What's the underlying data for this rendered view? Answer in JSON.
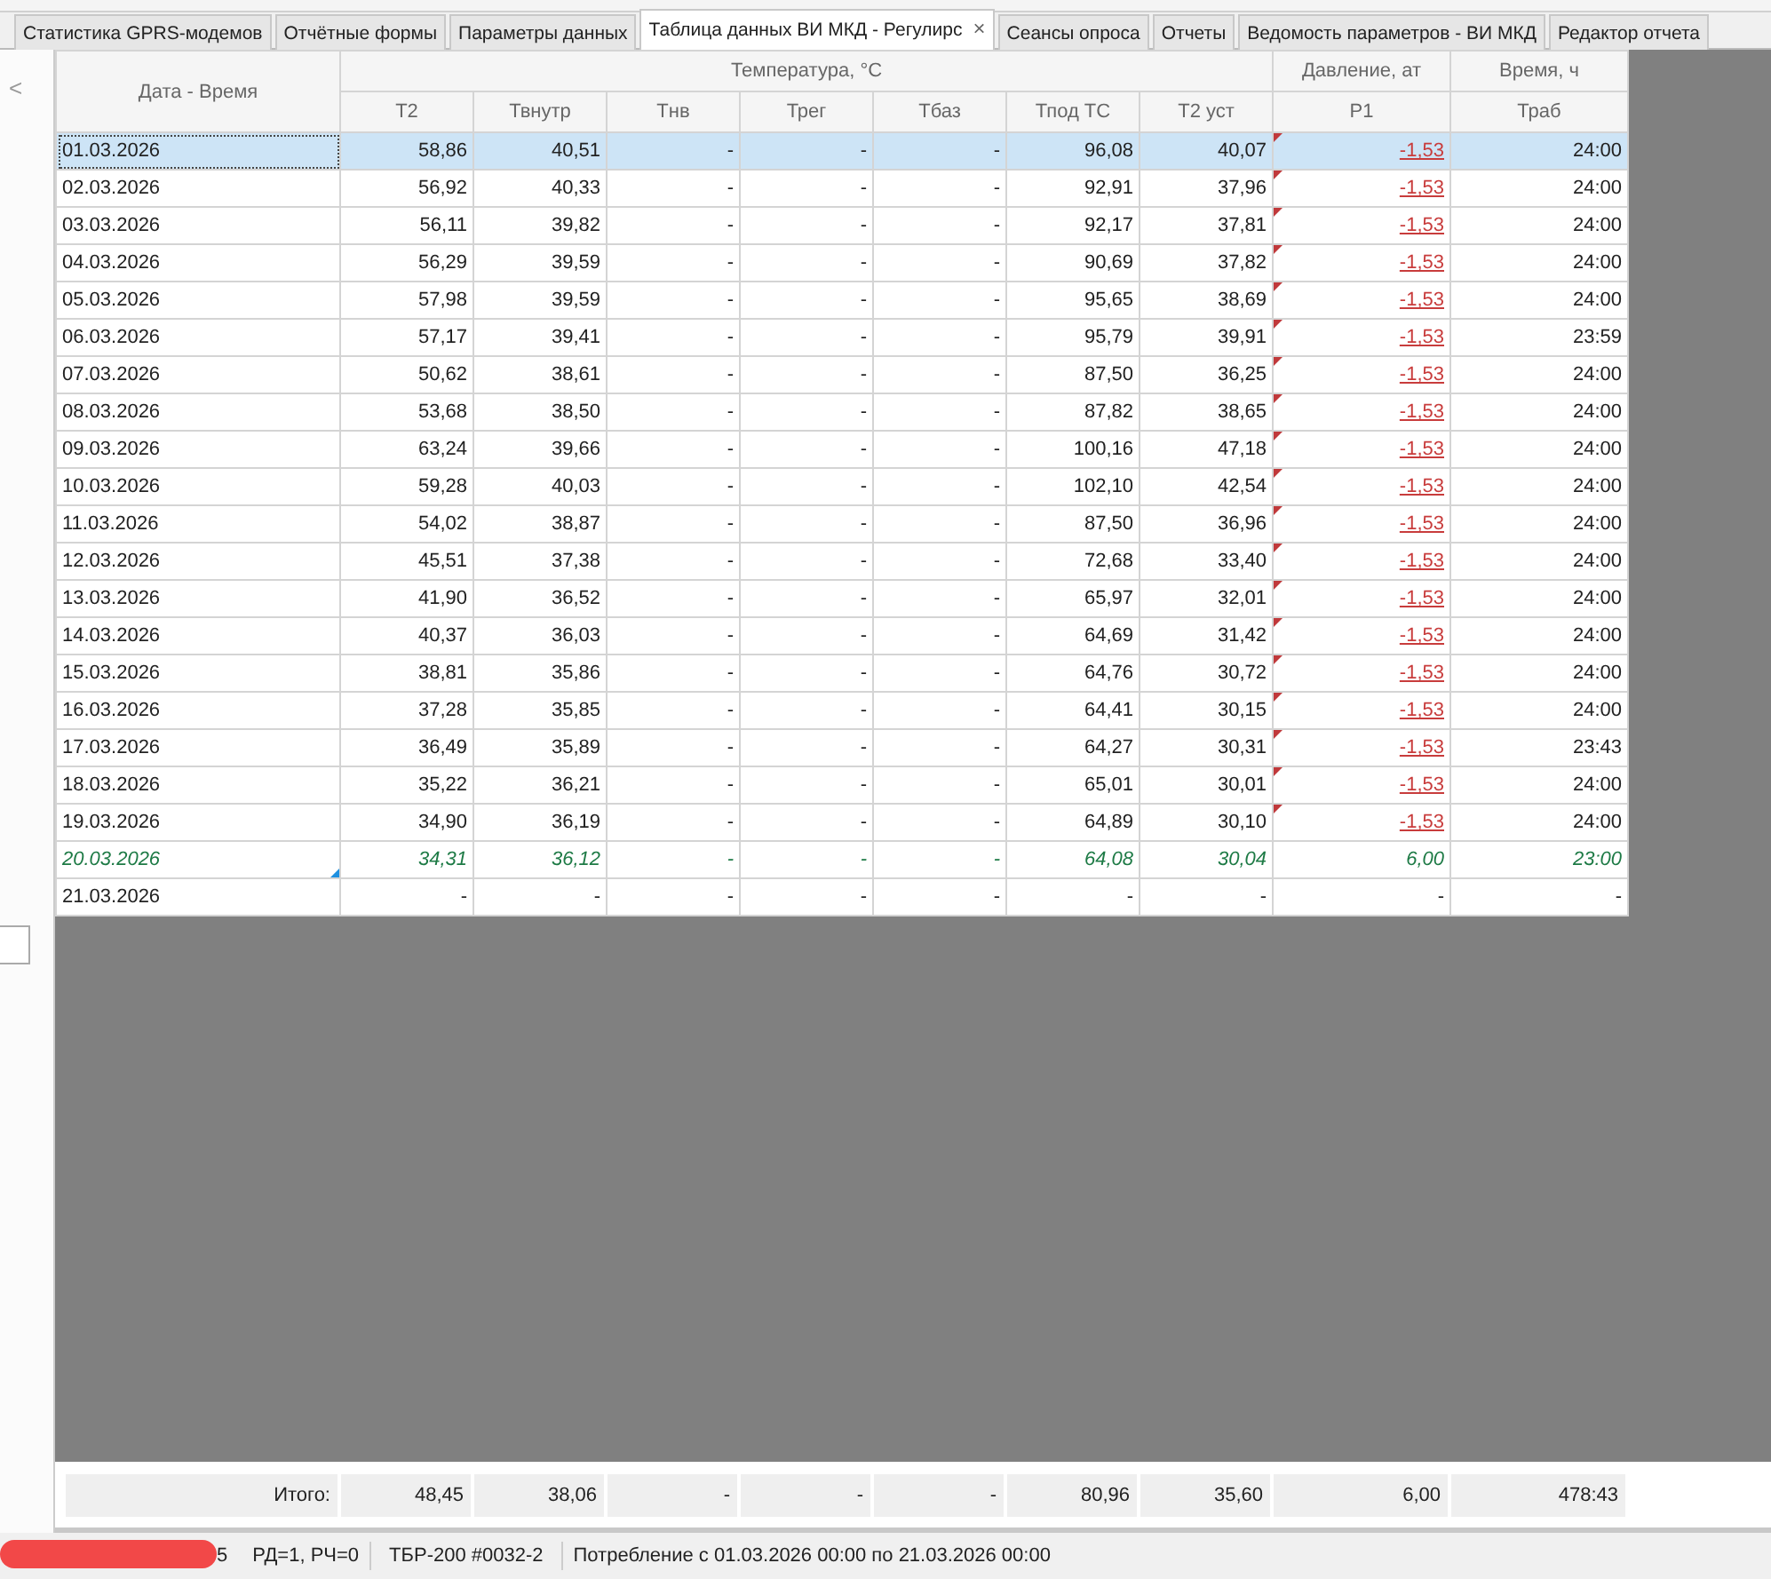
{
  "tabs": [
    {
      "label": "Статистика GPRS-модемов",
      "selected": false
    },
    {
      "label": "Отчётные формы",
      "selected": false
    },
    {
      "label": "Параметры данных",
      "selected": false
    },
    {
      "label": "Таблица данных ВИ МКД - Регулирс",
      "selected": true,
      "close": "×"
    },
    {
      "label": "Сеансы опроса",
      "selected": false
    },
    {
      "label": "Отчеты",
      "selected": false
    },
    {
      "label": "Ведомость параметров - ВИ МКД",
      "selected": false
    },
    {
      "label": "Редактор отчета",
      "selected": false
    }
  ],
  "side_panel": {
    "collapse": "<"
  },
  "table": {
    "row_header": "Дата - Время",
    "header_groups": [
      {
        "label": "Температура, °С",
        "columns": [
          "Т2",
          "Твнутр",
          "Тнв",
          "Трег",
          "Тбаз",
          "Тпод ТС",
          "Т2 уст"
        ]
      },
      {
        "label": "Давление, ат",
        "columns": [
          "P1"
        ]
      },
      {
        "label": "Время, ч",
        "columns": [
          "Траб"
        ]
      }
    ],
    "rows": [
      {
        "selected": true,
        "estimated": false,
        "note": false,
        "p1_alarm": true,
        "cells": [
          "01.03.2026",
          "58,86",
          "40,51",
          "-",
          "-",
          "-",
          "96,08",
          "40,07",
          "-1,53",
          "24:00"
        ]
      },
      {
        "selected": false,
        "estimated": false,
        "note": false,
        "p1_alarm": true,
        "cells": [
          "02.03.2026",
          "56,92",
          "40,33",
          "-",
          "-",
          "-",
          "92,91",
          "37,96",
          "-1,53",
          "24:00"
        ]
      },
      {
        "selected": false,
        "estimated": false,
        "note": false,
        "p1_alarm": true,
        "cells": [
          "03.03.2026",
          "56,11",
          "39,82",
          "-",
          "-",
          "-",
          "92,17",
          "37,81",
          "-1,53",
          "24:00"
        ]
      },
      {
        "selected": false,
        "estimated": false,
        "note": false,
        "p1_alarm": true,
        "cells": [
          "04.03.2026",
          "56,29",
          "39,59",
          "-",
          "-",
          "-",
          "90,69",
          "37,82",
          "-1,53",
          "24:00"
        ]
      },
      {
        "selected": false,
        "estimated": false,
        "note": false,
        "p1_alarm": true,
        "cells": [
          "05.03.2026",
          "57,98",
          "39,59",
          "-",
          "-",
          "-",
          "95,65",
          "38,69",
          "-1,53",
          "24:00"
        ]
      },
      {
        "selected": false,
        "estimated": false,
        "note": false,
        "p1_alarm": true,
        "cells": [
          "06.03.2026",
          "57,17",
          "39,41",
          "-",
          "-",
          "-",
          "95,79",
          "39,91",
          "-1,53",
          "23:59"
        ]
      },
      {
        "selected": false,
        "estimated": false,
        "note": false,
        "p1_alarm": true,
        "cells": [
          "07.03.2026",
          "50,62",
          "38,61",
          "-",
          "-",
          "-",
          "87,50",
          "36,25",
          "-1,53",
          "24:00"
        ]
      },
      {
        "selected": false,
        "estimated": false,
        "note": false,
        "p1_alarm": true,
        "cells": [
          "08.03.2026",
          "53,68",
          "38,50",
          "-",
          "-",
          "-",
          "87,82",
          "38,65",
          "-1,53",
          "24:00"
        ]
      },
      {
        "selected": false,
        "estimated": false,
        "note": false,
        "p1_alarm": true,
        "cells": [
          "09.03.2026",
          "63,24",
          "39,66",
          "-",
          "-",
          "-",
          "100,16",
          "47,18",
          "-1,53",
          "24:00"
        ]
      },
      {
        "selected": false,
        "estimated": false,
        "note": false,
        "p1_alarm": true,
        "cells": [
          "10.03.2026",
          "59,28",
          "40,03",
          "-",
          "-",
          "-",
          "102,10",
          "42,54",
          "-1,53",
          "24:00"
        ]
      },
      {
        "selected": false,
        "estimated": false,
        "note": false,
        "p1_alarm": true,
        "cells": [
          "11.03.2026",
          "54,02",
          "38,87",
          "-",
          "-",
          "-",
          "87,50",
          "36,96",
          "-1,53",
          "24:00"
        ]
      },
      {
        "selected": false,
        "estimated": false,
        "note": false,
        "p1_alarm": true,
        "cells": [
          "12.03.2026",
          "45,51",
          "37,38",
          "-",
          "-",
          "-",
          "72,68",
          "33,40",
          "-1,53",
          "24:00"
        ]
      },
      {
        "selected": false,
        "estimated": false,
        "note": false,
        "p1_alarm": true,
        "cells": [
          "13.03.2026",
          "41,90",
          "36,52",
          "-",
          "-",
          "-",
          "65,97",
          "32,01",
          "-1,53",
          "24:00"
        ]
      },
      {
        "selected": false,
        "estimated": false,
        "note": false,
        "p1_alarm": true,
        "cells": [
          "14.03.2026",
          "40,37",
          "36,03",
          "-",
          "-",
          "-",
          "64,69",
          "31,42",
          "-1,53",
          "24:00"
        ]
      },
      {
        "selected": false,
        "estimated": false,
        "note": false,
        "p1_alarm": true,
        "cells": [
          "15.03.2026",
          "38,81",
          "35,86",
          "-",
          "-",
          "-",
          "64,76",
          "30,72",
          "-1,53",
          "24:00"
        ]
      },
      {
        "selected": false,
        "estimated": false,
        "note": false,
        "p1_alarm": true,
        "cells": [
          "16.03.2026",
          "37,28",
          "35,85",
          "-",
          "-",
          "-",
          "64,41",
          "30,15",
          "-1,53",
          "24:00"
        ]
      },
      {
        "selected": false,
        "estimated": false,
        "note": false,
        "p1_alarm": true,
        "cells": [
          "17.03.2026",
          "36,49",
          "35,89",
          "-",
          "-",
          "-",
          "64,27",
          "30,31",
          "-1,53",
          "23:43"
        ]
      },
      {
        "selected": false,
        "estimated": false,
        "note": false,
        "p1_alarm": true,
        "cells": [
          "18.03.2026",
          "35,22",
          "36,21",
          "-",
          "-",
          "-",
          "65,01",
          "30,01",
          "-1,53",
          "24:00"
        ]
      },
      {
        "selected": false,
        "estimated": false,
        "note": false,
        "p1_alarm": true,
        "cells": [
          "19.03.2026",
          "34,90",
          "36,19",
          "-",
          "-",
          "-",
          "64,89",
          "30,10",
          "-1,53",
          "24:00"
        ]
      },
      {
        "selected": false,
        "estimated": true,
        "note": true,
        "p1_alarm": false,
        "cells": [
          "20.03.2026",
          "34,31",
          "36,12",
          "-",
          "-",
          "-",
          "64,08",
          "30,04",
          "6,00",
          "23:00"
        ]
      },
      {
        "selected": false,
        "estimated": false,
        "note": false,
        "p1_alarm": false,
        "cells": [
          "21.03.2026",
          "-",
          "-",
          "-",
          "-",
          "-",
          "-",
          "-",
          "-",
          "-"
        ]
      }
    ],
    "totals": [
      "Итого:",
      "48,45",
      "38,06",
      "-",
      "-",
      "-",
      "80,96",
      "35,60",
      "6,00",
      "478:43"
    ]
  },
  "status_bar": [
    "5",
    "РД=1, РЧ=0",
    "ТБР-200 #0032-2",
    "Потребление с 01.03.2026 00:00 по 21.03.2026 00:00"
  ]
}
